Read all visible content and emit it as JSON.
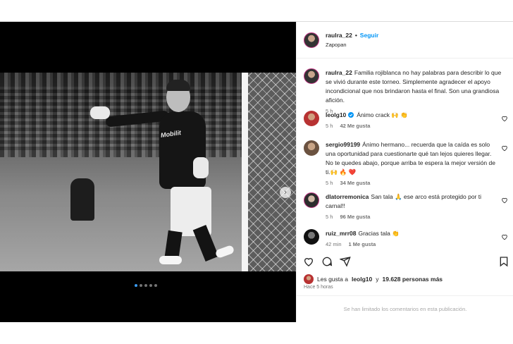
{
  "post": {
    "username": "raulra_22",
    "follow_label": "Seguir",
    "location": "Zapopan",
    "caption": "Familia rojiblanca no hay palabras para describir lo que se vivió durante este torneo. Simplemente agradecer el apoyo incondicional que nos brindaron hasta el final. Son una grandiosa afición.",
    "caption_time": "5 h",
    "photo_logo_text": "Mobilit"
  },
  "comments": [
    {
      "user": "leolg10",
      "text": "Ánimo crack 🙌 👏",
      "time": "5 h",
      "likes": "42 Me gusta",
      "reply": "",
      "avatar": "av-leo"
    },
    {
      "user": "sergio99199",
      "text": "Ánimo hermano... recuerda que la caída es solo una oportunidad para cuestionarte qué tan lejos quieres llegar. No te quedes abajo, porque arriba te espera la mejor versión de ti.🙌 🔥 ❤️",
      "time": "5 h",
      "likes": "34 Me gusta",
      "reply": "",
      "avatar": "av-ser"
    },
    {
      "user": "dlatorremonica",
      "text": "San tala 🙏 ese arco está protegido por ti carnal!!",
      "time": "5 h",
      "likes": "96 Me gusta",
      "reply": "",
      "avatar": "av-dla"
    },
    {
      "user": "ruiz_mrr08",
      "text": "Gracias tala 👏",
      "time": "42 min",
      "likes": "1 Me gusta",
      "reply": "",
      "avatar": "av-ruiz"
    }
  ],
  "likes_summary": {
    "prefix": "Les gusta a",
    "user": "leolg10",
    "middle": "y",
    "count": "19.628 personas más"
  },
  "posted_ago": "Hace 5 horas",
  "comments_limited": "Se han limitado los comentarios en esta publicación.",
  "carousel": {
    "total": 5,
    "active_index": 0
  },
  "icons": {
    "like": "heart-icon",
    "comment": "comment-icon",
    "share": "send-icon",
    "save": "bookmark-icon",
    "next": "chevron-right-icon",
    "verified": "verified-badge-icon"
  },
  "colors": {
    "link_blue": "#0095f6",
    "verified": "#0095f6",
    "muted": "#737373"
  }
}
